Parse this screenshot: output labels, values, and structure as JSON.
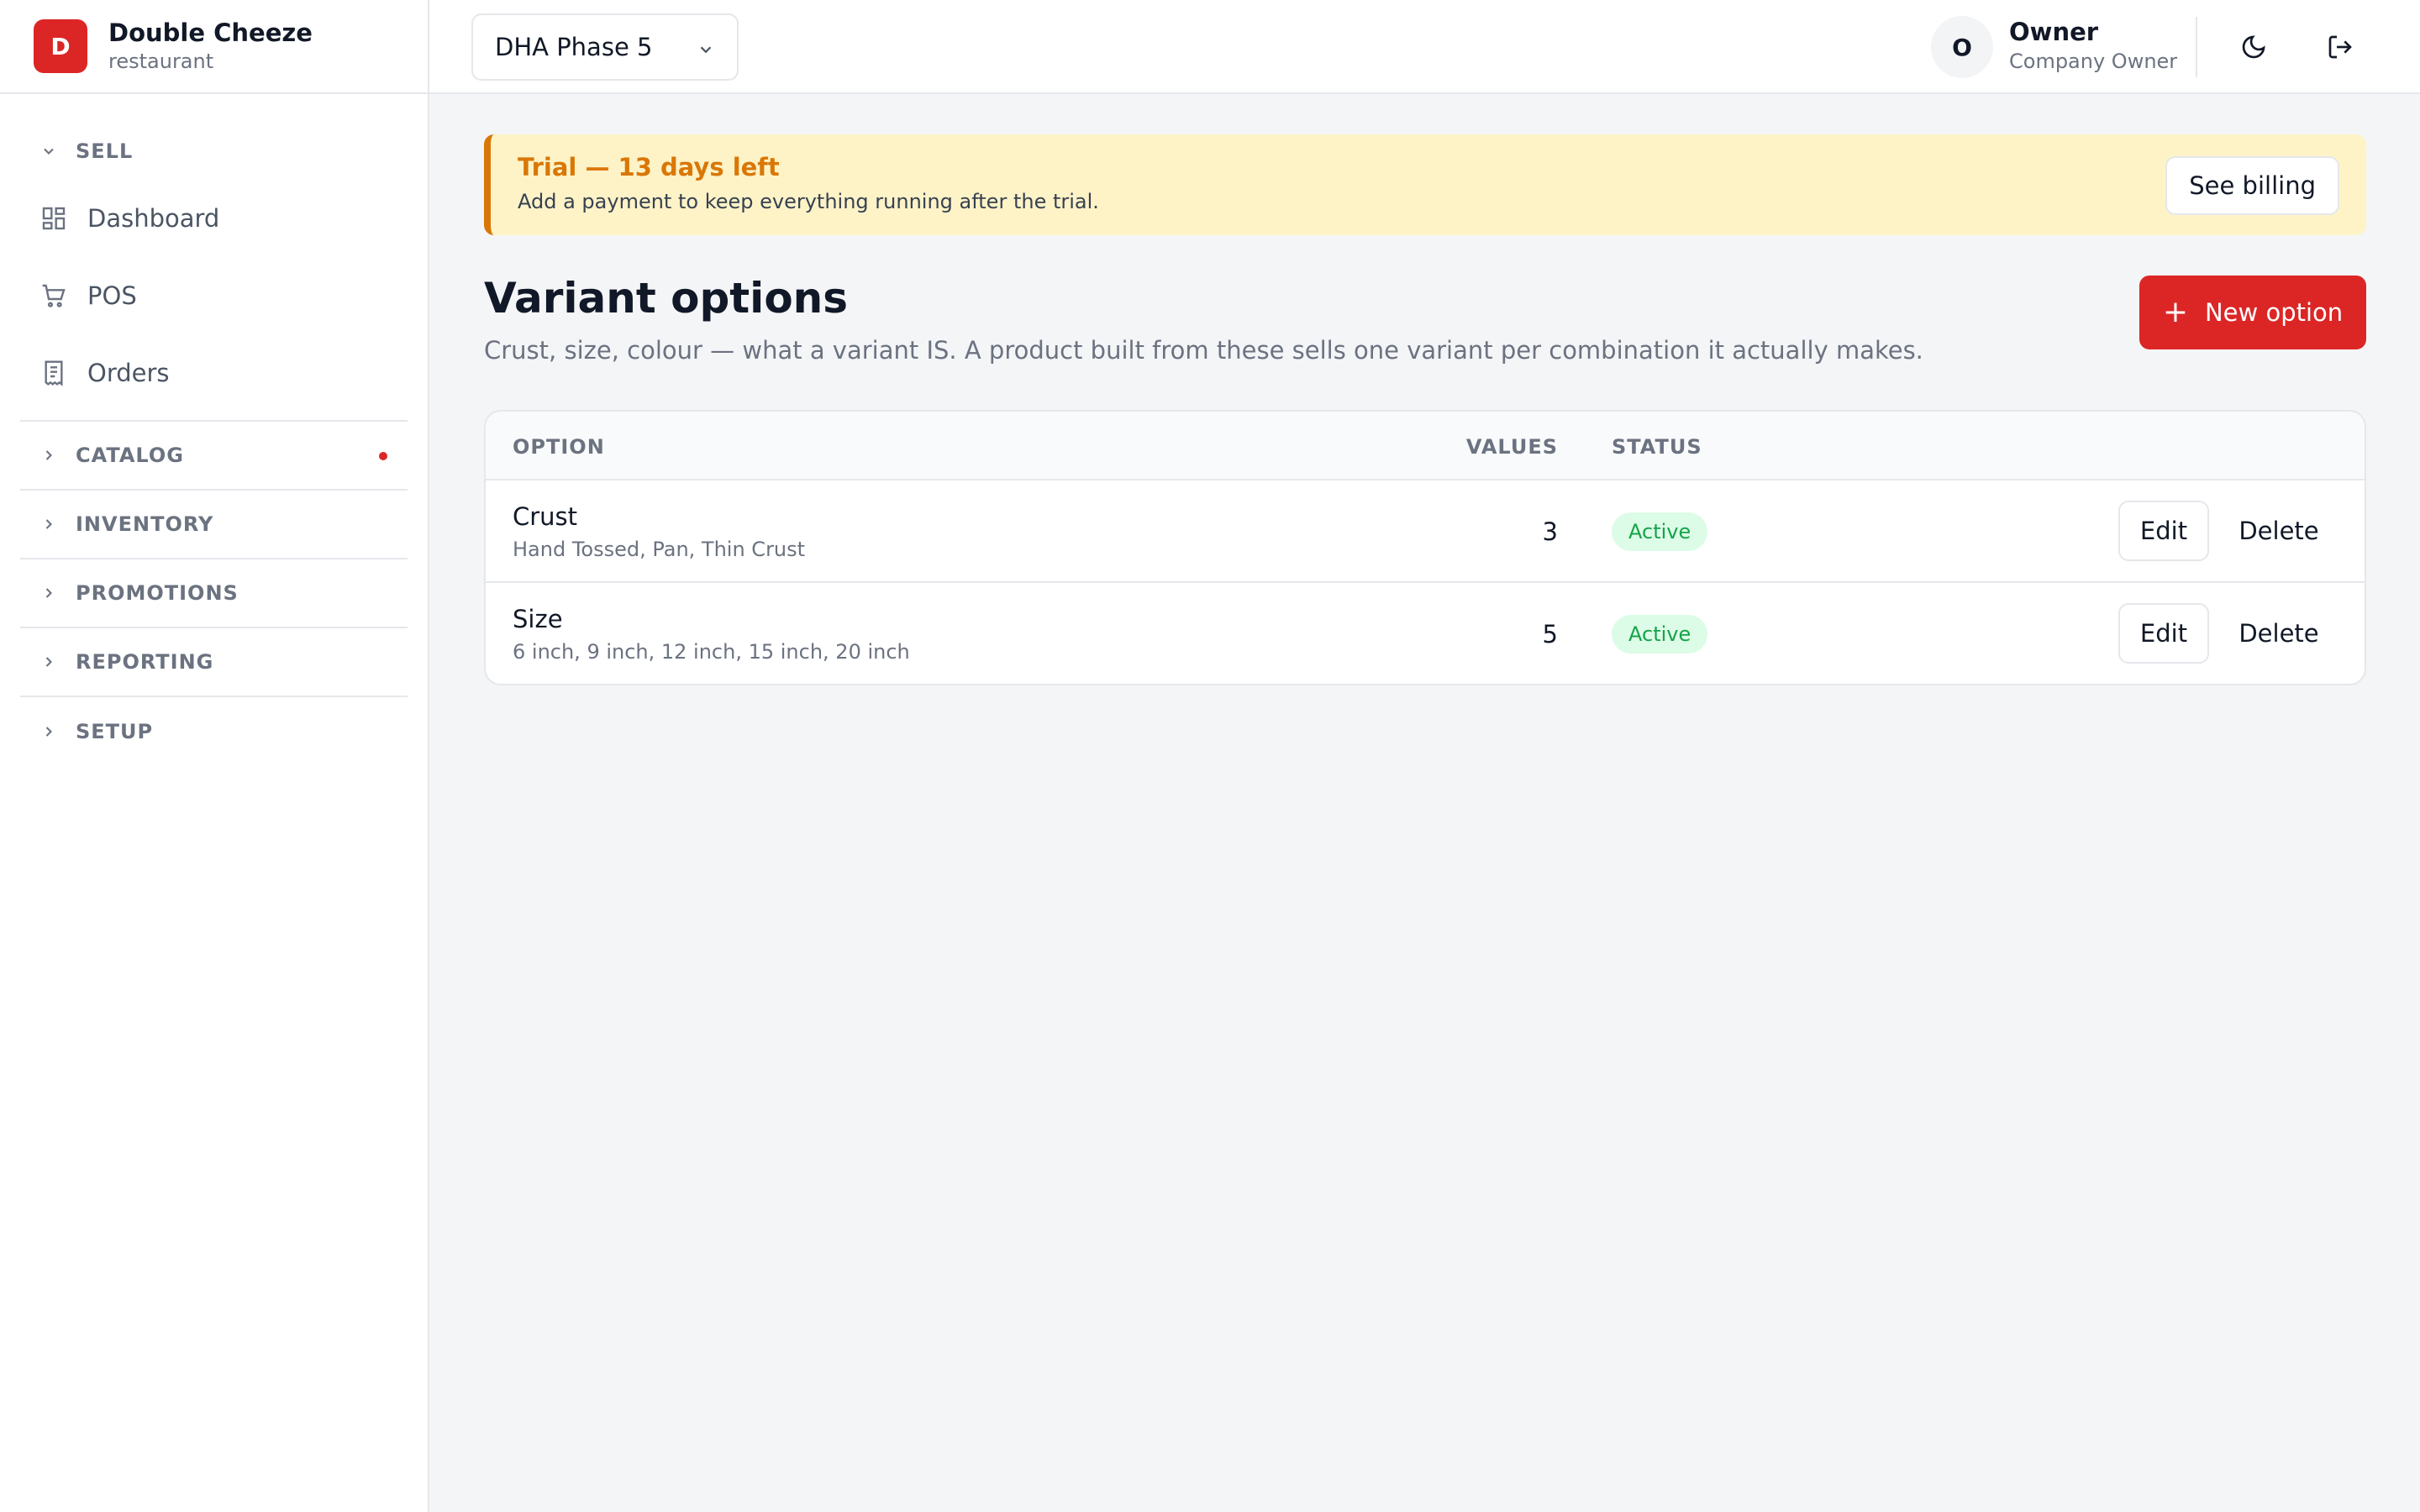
{
  "brand": {
    "logo_letter": "D",
    "name": "Double Cheeze",
    "type": "restaurant"
  },
  "sidebar": {
    "sell": {
      "label": "SELL",
      "items": [
        {
          "label": "Dashboard",
          "icon": "dashboard-icon"
        },
        {
          "label": "POS",
          "icon": "cart-icon"
        },
        {
          "label": "Orders",
          "icon": "receipt-icon"
        }
      ]
    },
    "sections": [
      {
        "label": "CATALOG",
        "has_dot": true
      },
      {
        "label": "INVENTORY"
      },
      {
        "label": "PROMOTIONS"
      },
      {
        "label": "REPORTING"
      },
      {
        "label": "SETUP"
      }
    ]
  },
  "topbar": {
    "branch": "DHA Phase 5",
    "user": {
      "initial": "O",
      "name": "Owner",
      "role": "Company Owner"
    },
    "icons": [
      "moon-icon",
      "logout-icon"
    ]
  },
  "trial": {
    "title": "Trial — 13 days left",
    "text": "Add a payment to keep everything running after the trial.",
    "button": "See billing"
  },
  "page": {
    "title": "Variant options",
    "description": "Crust, size, colour — what a variant IS. A product built from these sells one variant per combination it actually makes.",
    "new_button": "New option",
    "new_button_icon": "plus-icon"
  },
  "table": {
    "headers": {
      "option": "OPTION",
      "values": "VALUES",
      "status": "STATUS"
    },
    "rows": [
      {
        "name": "Crust",
        "values": "Hand Tossed, Pan, Thin Crust",
        "count": "3",
        "status": "Active",
        "edit": "Edit",
        "delete": "Delete"
      },
      {
        "name": "Size",
        "values": "6 inch, 9 inch, 12 inch, 15 inch, 20 inch",
        "count": "5",
        "status": "Active",
        "edit": "Edit",
        "delete": "Delete"
      }
    ]
  },
  "colors": {
    "accent": "#dc2626",
    "trial_bg": "#fef3c7",
    "trial_border": "#d97706",
    "active_badge_bg": "#dcfce7",
    "active_badge_text": "#16a34a"
  }
}
